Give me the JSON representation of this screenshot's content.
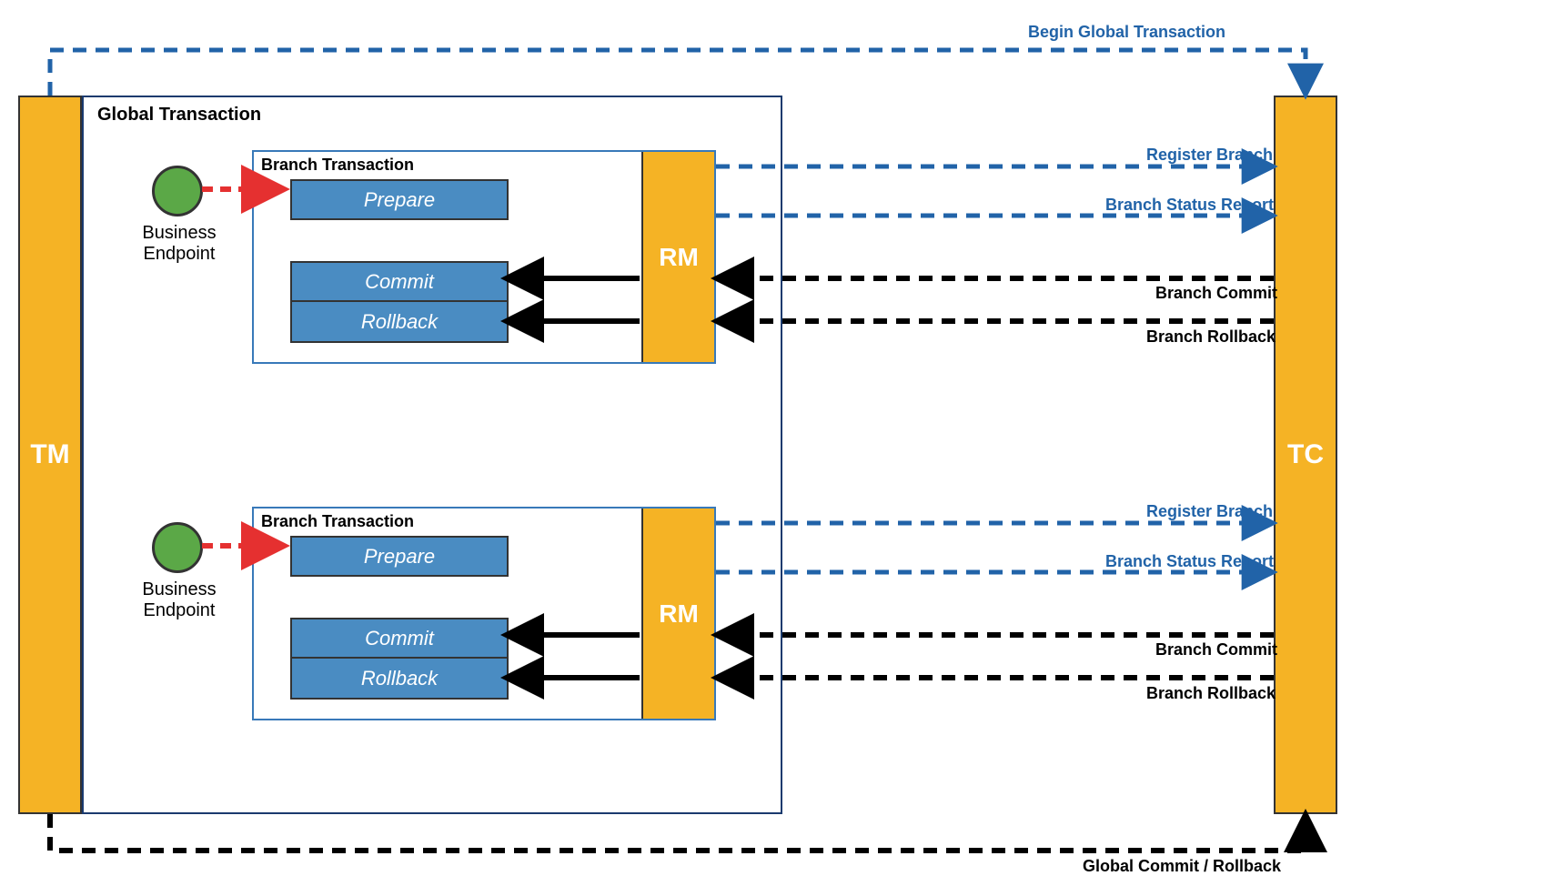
{
  "nodes": {
    "tm": "TM",
    "tc": "TC",
    "global_title": "Global Transaction",
    "branch_title": "Branch Transaction",
    "rm": "RM",
    "prepare": "Prepare",
    "commit": "Commit",
    "rollback": "Rollback",
    "endpoint_label": "Business Endpoint"
  },
  "arrows": {
    "begin_global": "Begin Global Transaction",
    "register_branch": "Register Branch",
    "branch_status": "Branch Status Report",
    "branch_commit": "Branch Commit",
    "branch_rollback": "Branch Rollback",
    "global_commit_rollback": "Global Commit / Rollback"
  },
  "colors": {
    "blue": "#2163a8",
    "orange": "#f5b325",
    "green": "#5ba847",
    "red": "#e53030",
    "black": "#000000"
  }
}
